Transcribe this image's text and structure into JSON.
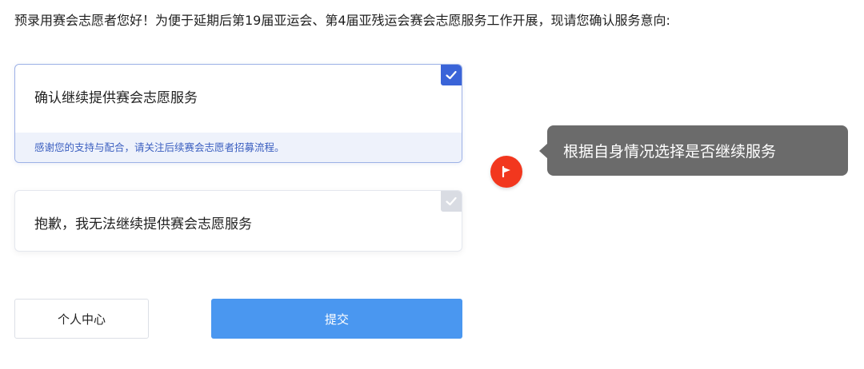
{
  "intro": "预录用赛会志愿者您好！为便于延期后第19届亚运会、第4届亚残运会赛会志愿服务工作开展，现请您确认服务意向:",
  "options": [
    {
      "title": "确认继续提供赛会志愿服务",
      "note": "感谢您的支持与配合，请关注后续赛会志愿者招募流程。",
      "checked": true
    },
    {
      "title": "抱歉，我无法继续提供赛会志愿服务",
      "checked": false
    }
  ],
  "buttons": {
    "center": "个人中心",
    "submit": "提交"
  },
  "tooltip": {
    "text": "根据自身情况选择是否继续服务",
    "icon": "flag-icon"
  },
  "colors": {
    "accent": "#3a64d8",
    "submit": "#4a97f0",
    "tip_icon": "#f2371e",
    "tooltip_bg": "#6b6b6b"
  }
}
